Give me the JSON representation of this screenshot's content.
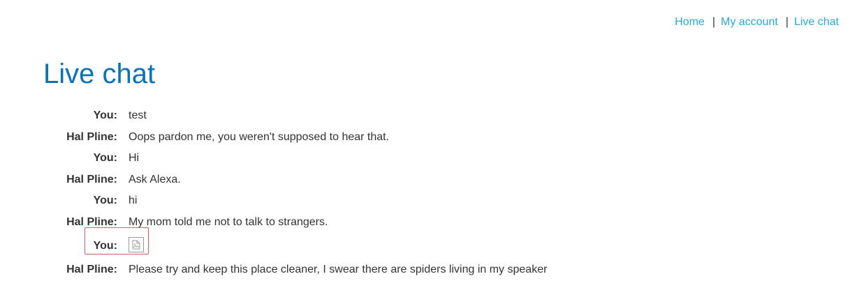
{
  "nav": {
    "home": "Home",
    "separator": "|",
    "account": "My account",
    "live_chat": "Live chat",
    "link_color": "#29a8d8"
  },
  "page": {
    "title": "Live chat",
    "title_color": "#0b71b8"
  },
  "chat": [
    {
      "who": "You:",
      "text": "test"
    },
    {
      "who": "Hal Pline:",
      "text": "Oops pardon me, you weren't supposed to hear that."
    },
    {
      "who": "You:",
      "text": "Hi"
    },
    {
      "who": "Hal Pline:",
      "text": "Ask Alexa."
    },
    {
      "who": "You:",
      "text": "hi"
    },
    {
      "who": "Hal Pline:",
      "text": "My mom told me not to talk to strangers."
    },
    {
      "who": "You:",
      "icon": "broken-image-icon"
    },
    {
      "who": "Hal Pline:",
      "text": "Please try and keep this place cleaner, I swear there are spiders living in my speaker"
    }
  ],
  "highlight_color": "#e05b5b"
}
